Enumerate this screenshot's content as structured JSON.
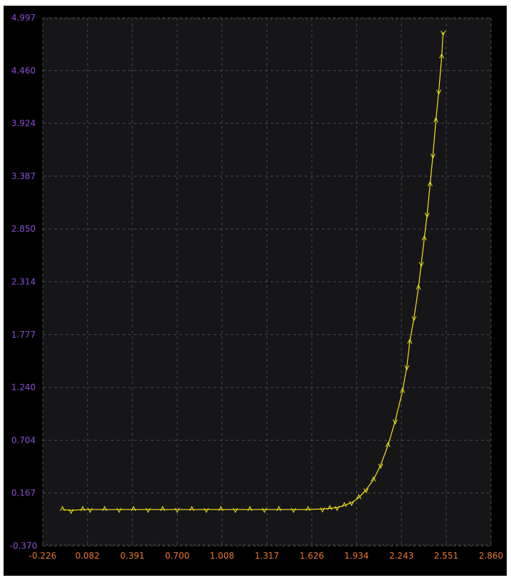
{
  "chart_data": {
    "type": "line",
    "title": "",
    "xlabel": "",
    "ylabel": "",
    "xlim": [
      -0.226,
      2.86
    ],
    "ylim": [
      -0.37,
      4.997
    ],
    "x_ticks": [
      "-0.226",
      "0.082",
      "0.391",
      "0.700",
      "1.008",
      "1.317",
      "1.626",
      "1.934",
      "2.243",
      "2.551",
      "2.860"
    ],
    "y_ticks": [
      "4.997",
      "4.460",
      "3.924",
      "3.387",
      "2.850",
      "2.314",
      "1.777",
      "1.240",
      "0.704",
      "0.167",
      "-0.370"
    ],
    "grid": true,
    "colors": {
      "background": "#000000",
      "plot_area": "#161618",
      "grid": "#4a4a4e",
      "series": "#f5e51e",
      "x_tick_labels": "#e8782e",
      "y_tick_labels": "#8a4fd0"
    },
    "series": [
      {
        "x": [
          -0.09,
          -0.03,
          0.05,
          0.1,
          0.2,
          0.3,
          0.4,
          0.5,
          0.6,
          0.7,
          0.8,
          0.9,
          1.0,
          1.1,
          1.2,
          1.3,
          1.4,
          1.5,
          1.6,
          1.7,
          1.75,
          1.8,
          1.85,
          1.9,
          1.95,
          2.0,
          2.05,
          2.1,
          2.15,
          2.2,
          2.25,
          2.28,
          2.3,
          2.33,
          2.36,
          2.38,
          2.4,
          2.42,
          2.44,
          2.46,
          2.48,
          2.5,
          2.52,
          2.53
        ],
        "y": [
          0.0,
          -0.01,
          0.0,
          0.0,
          0.0,
          0.0,
          0.0,
          0.0,
          0.0,
          0.0,
          0.0,
          0.0,
          0.0,
          0.0,
          0.0,
          0.0,
          0.0,
          0.0,
          0.0,
          0.005,
          0.01,
          0.02,
          0.04,
          0.07,
          0.12,
          0.2,
          0.3,
          0.45,
          0.65,
          0.9,
          1.2,
          1.45,
          1.7,
          1.95,
          2.25,
          2.5,
          2.75,
          3.0,
          3.3,
          3.6,
          3.95,
          4.25,
          4.6,
          4.85
        ]
      }
    ]
  }
}
